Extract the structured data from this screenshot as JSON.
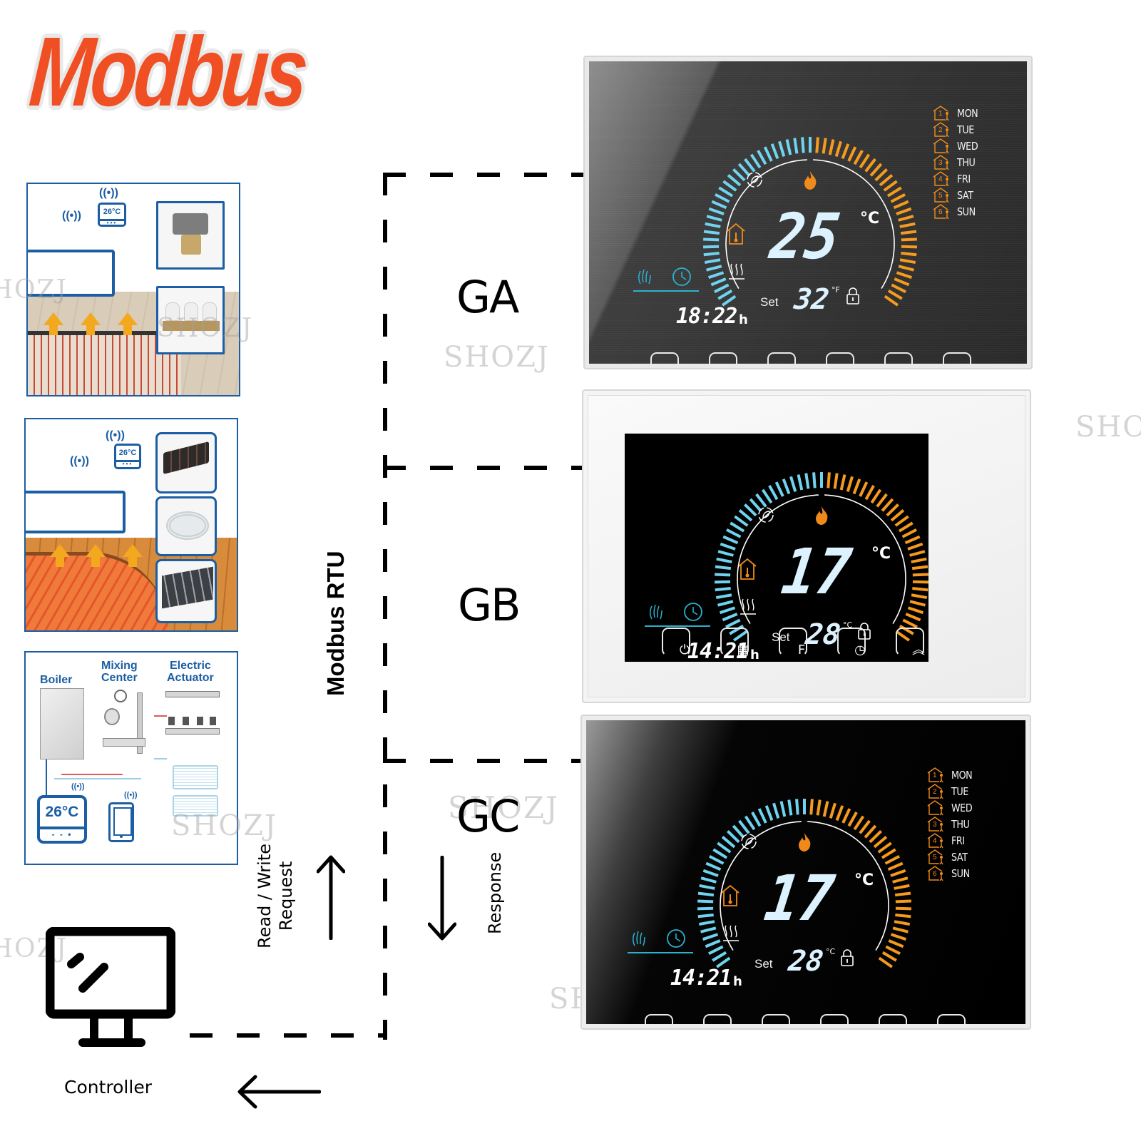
{
  "title": "Modbus",
  "watermark": "SHOZJ",
  "bus": {
    "protocol_label": "Modbus RTU",
    "request_label_line1": "Read / Write",
    "request_label_line2": "Request",
    "response_label": "Response"
  },
  "groups": [
    {
      "id": "GA",
      "label": "GA"
    },
    {
      "id": "GB",
      "label": "GB"
    },
    {
      "id": "GC",
      "label": "GC"
    }
  ],
  "controller": {
    "label": "Controller",
    "icon": "monitor-icon"
  },
  "applications": [
    {
      "name": "water-floor-heating",
      "thermostat_reading": "26°C",
      "products": [
        "motorized-valve",
        "manifold-actuators"
      ]
    },
    {
      "name": "electric-floor-heating",
      "thermostat_reading": "26°C",
      "products": [
        "heating-film",
        "heating-cable",
        "heating-board"
      ]
    },
    {
      "name": "boiler-system",
      "labels": {
        "boiler": "Boiler",
        "mixing_line1": "Mixing",
        "mixing_line2": "Center",
        "actuator_line1": "Electric",
        "actuator_line2": "Actuator"
      },
      "thermostat_reading": "26°C",
      "thermostat_foot": "- - •"
    }
  ],
  "thermostats": [
    {
      "group": "GA",
      "finish": "brushed-grey",
      "current_temp": "25",
      "current_unit": "°C",
      "set_label": "Set",
      "set_temp": "32",
      "set_unit": "°F",
      "clock": "18:22",
      "clock_unit": "h"
    },
    {
      "group": "GB",
      "finish": "white",
      "current_temp": "17",
      "current_unit": "°C",
      "set_label": "Set",
      "set_temp": "28",
      "set_unit": "°C",
      "clock": "14:21",
      "clock_unit": "h"
    },
    {
      "group": "GC",
      "finish": "black",
      "current_temp": "17",
      "current_unit": "°C",
      "set_label": "Set",
      "set_temp": "28",
      "set_unit": "°C",
      "clock": "14:21",
      "clock_unit": "h"
    }
  ],
  "thermostat_common": {
    "days": [
      {
        "label": "MON",
        "program": "1"
      },
      {
        "label": "TUE",
        "program": "2"
      },
      {
        "label": "WED",
        "program": ""
      },
      {
        "label": "THU",
        "program": "3"
      },
      {
        "label": "FRI",
        "program": "4"
      },
      {
        "label": "SAT",
        "program": "5"
      },
      {
        "label": "SUN",
        "program": "6"
      }
    ],
    "status_icons": [
      "eco-leaf-icon",
      "flame-icon",
      "house-thermometer-icon",
      "floor-heat-icon",
      "lock-icon",
      "manual-hand-icon",
      "schedule-clock-icon"
    ],
    "buttons": [
      {
        "name": "power-button",
        "icon": "power-icon",
        "glyph": "⏻"
      },
      {
        "name": "mode-button",
        "icon": "grid-icon",
        "glyph": "▦"
      },
      {
        "name": "function-button",
        "icon": "f-icon",
        "glyph": "F"
      },
      {
        "name": "schedule-button",
        "icon": "clock-icon",
        "glyph": "◷"
      },
      {
        "name": "up-button",
        "icon": "double-chevron-up-icon",
        "glyph": "︽"
      },
      {
        "name": "down-button",
        "icon": "double-chevron-down-icon",
        "glyph": "︾"
      }
    ],
    "colors": {
      "cold_arc": "#6fd3ef",
      "warm_arc": "#f59a1c",
      "icon_orange": "#ef8a1a",
      "accent_cyan": "#2ab1cf",
      "digit": "#dcf3ff"
    }
  }
}
